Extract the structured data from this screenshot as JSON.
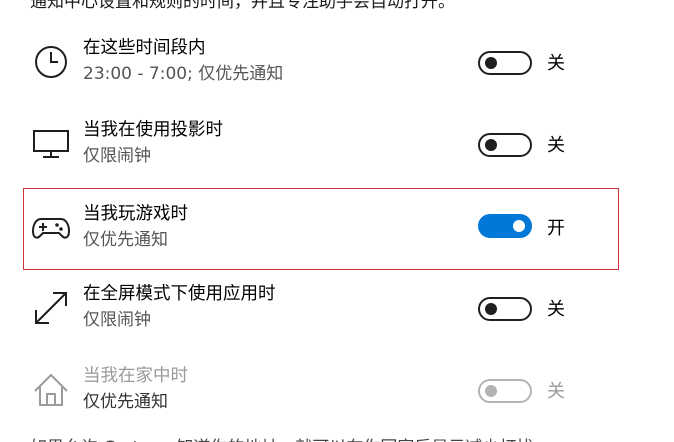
{
  "top_partial_text": "通知中心设置和规则的时间，并且专注助手会自动打开。",
  "bottom_partial_text": "如果允许 Cortana 知道你的地址，就可以在你回家后显示减少打扰",
  "rules": [
    {
      "icon": "clock-icon",
      "title": "在这些时间段内",
      "subtitle": "23:00 - 7:00; 仅优先通知",
      "state_label": "关",
      "on": false,
      "enabled": true
    },
    {
      "icon": "monitor-icon",
      "title": "当我在使用投影时",
      "subtitle": "仅限闹钟",
      "state_label": "关",
      "on": false,
      "enabled": true
    },
    {
      "icon": "gamepad-icon",
      "title": "当我玩游戏时",
      "subtitle": "仅优先通知",
      "state_label": "开",
      "on": true,
      "enabled": true
    },
    {
      "icon": "fullscreen-icon",
      "title": "在全屏模式下使用应用时",
      "subtitle": "仅限闹钟",
      "state_label": "关",
      "on": false,
      "enabled": true
    },
    {
      "icon": "home-icon",
      "title": "当我在家中时",
      "subtitle": "仅优先通知",
      "state_label": "关",
      "on": false,
      "enabled": false
    }
  ],
  "colors": {
    "accent": "#0078d7",
    "focus_border": "#d13438",
    "disabled": "#9a9a9a"
  }
}
